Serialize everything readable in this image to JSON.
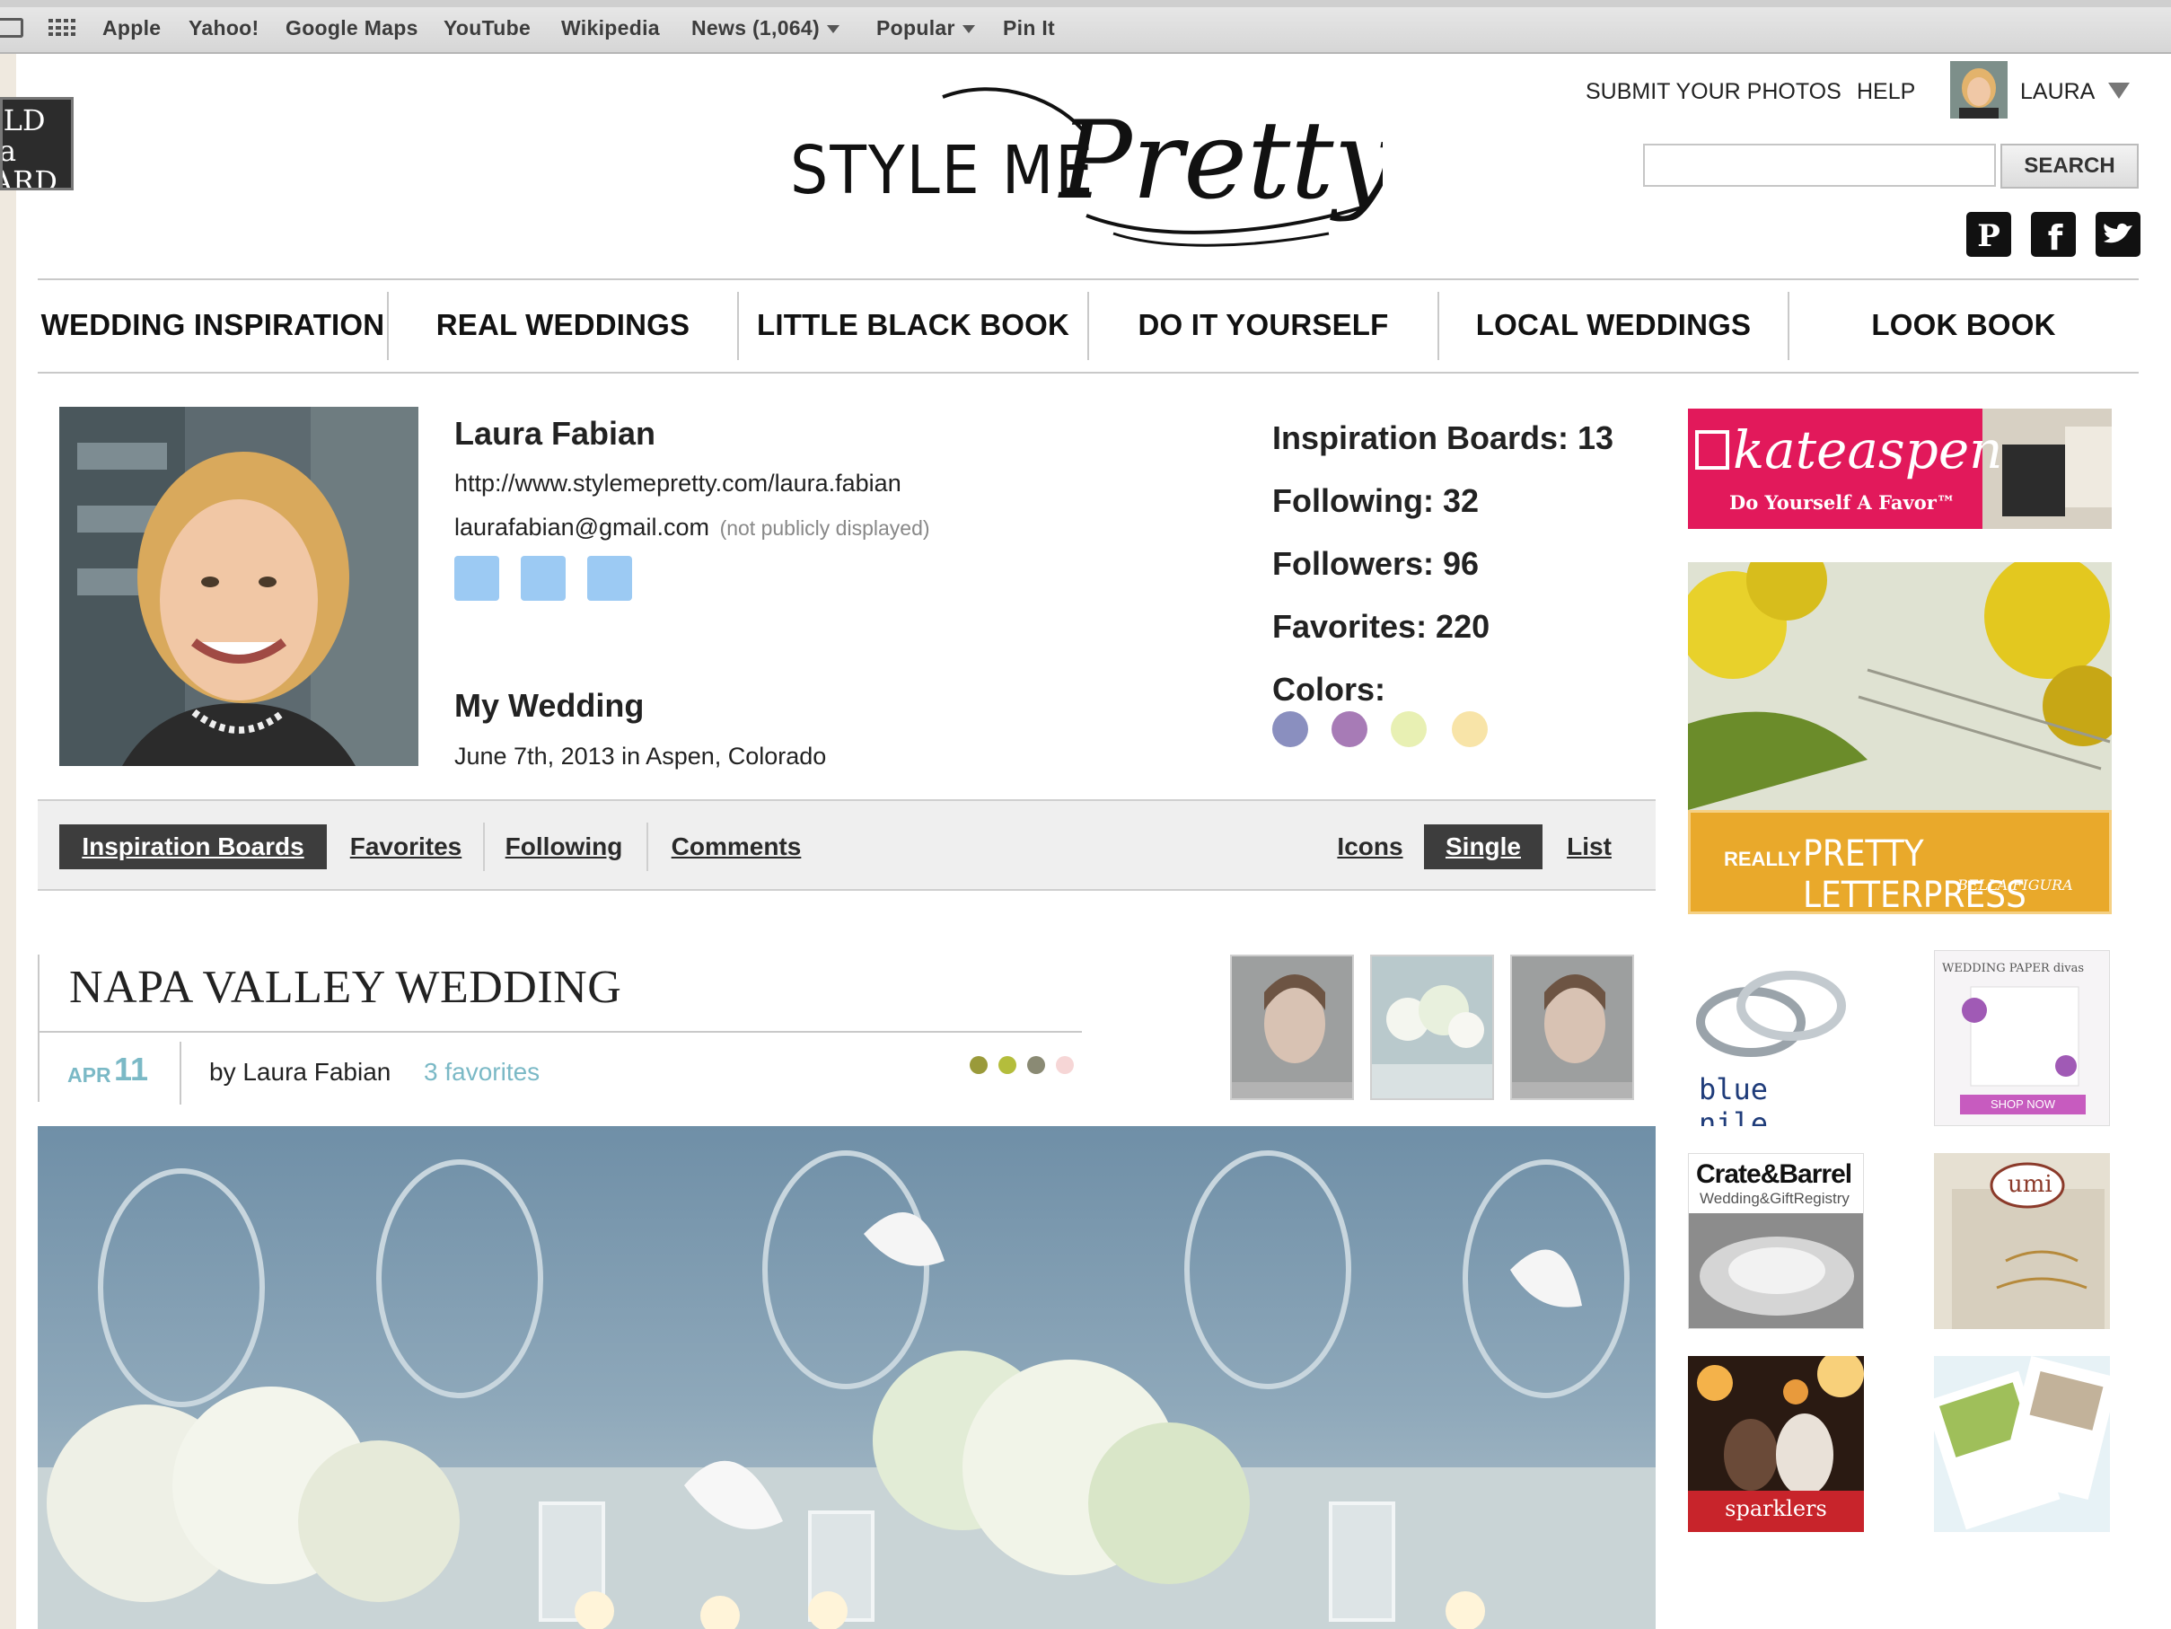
{
  "bookmarks": {
    "items": [
      "Apple",
      "Yahoo!",
      "Google Maps",
      "YouTube",
      "Wikipedia",
      "News (1,064)",
      "Popular",
      "Pin It"
    ]
  },
  "badge": {
    "lines": [
      "ILD",
      "a",
      "ARD"
    ]
  },
  "header": {
    "logo_left": "STYLE ME",
    "logo_right": "Pretty",
    "submit_label": "SUBMIT YOUR PHOTOS",
    "help_label": "HELP",
    "user_name": "LAURA",
    "search_placeholder": "",
    "search_button": "SEARCH",
    "social_icons": [
      "pinterest-icon",
      "facebook-icon",
      "twitter-icon"
    ]
  },
  "nav": {
    "items": [
      "WEDDING INSPIRATION",
      "REAL WEDDINGS",
      "LITTLE BLACK BOOK",
      "DO IT YOURSELF",
      "LOCAL WEDDINGS",
      "LOOK BOOK"
    ]
  },
  "profile": {
    "name": "Laura Fabian",
    "url": "http://www.stylemepretty.com/laura.fabian",
    "email": "laurafabian@gmail.com",
    "email_note": "(not publicly displayed)",
    "wedding_title": "My Wedding",
    "wedding_date": "June 7th, 2013 in Aspen, Colorado",
    "stats": {
      "boards": "Inspiration Boards: 13",
      "following": "Following: 32",
      "followers": "Followers: 96",
      "favorites": "Favorites: 220",
      "colors_label": "Colors:"
    },
    "colors": [
      "#8a8fbf",
      "#a77bb6",
      "#e8f0b3",
      "#f8e4a8"
    ],
    "link_square_color": "#9ccaf3"
  },
  "tabs": {
    "left": [
      "Inspiration Boards",
      "Favorites",
      "Following",
      "Comments"
    ],
    "right": [
      "Icons",
      "Single",
      "List"
    ],
    "active_left": "Inspiration Boards",
    "active_right": "Single"
  },
  "post": {
    "title": "NAPA VALLEY WEDDING",
    "month": "APR",
    "day": "11",
    "by": "by Laura Fabian",
    "favorites": "3 favorites",
    "colors": [
      "#9a9a3a",
      "#b4bd3c",
      "#8a8a74",
      "#f6d6d6"
    ]
  },
  "ads": {
    "kate_aspen": {
      "brand": "kateaspen",
      "tagline": "Do Yourself A Favor™"
    },
    "letterpress": {
      "prefix": "REALLY",
      "headline": "PRETTY LETTERPRESS",
      "sub": "BELLA FIGURA"
    },
    "blue_nile": {
      "brand": "blue nile."
    },
    "wedding_paper": {
      "brand": "WEDDING PAPER divas",
      "cta": "SHOP NOW"
    },
    "crate_barrel": {
      "brand": "Crate&Barrel",
      "sub": "Wedding&GiftRegistry"
    },
    "umi": {
      "brand": "umi"
    },
    "sparklers": {
      "label": "sparklers"
    }
  },
  "colors": {
    "accent": "#7bb9c6",
    "active_tab": "#3d3d3d",
    "kate_pink": "#e2195b",
    "letterpress_yellow": "#e9a92b"
  }
}
